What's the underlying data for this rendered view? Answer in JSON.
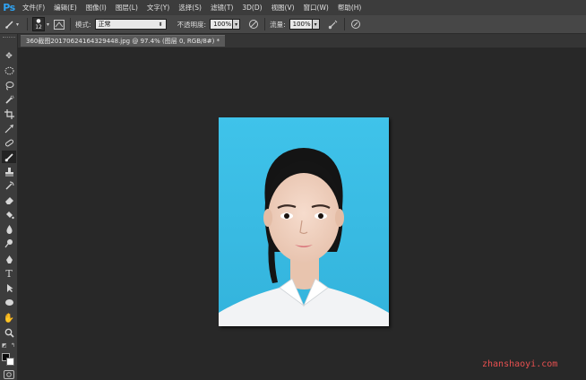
{
  "app": {
    "logo": "Ps"
  },
  "menu": [
    "文件(F)",
    "编辑(E)",
    "图像(I)",
    "图层(L)",
    "文字(Y)",
    "选择(S)",
    "滤镜(T)",
    "3D(D)",
    "视图(V)",
    "窗口(W)",
    "帮助(H)"
  ],
  "options": {
    "brush_size": "12",
    "mode_label": "模式:",
    "mode_value": "正常",
    "opacity_label": "不透明度:",
    "opacity_value": "100%",
    "flow_label": "流量:",
    "flow_value": "100%"
  },
  "document": {
    "tab_title": "360截图20170624164329448.jpg @ 97.4% (图层 0, RGB/8#) *"
  },
  "colors": {
    "foreground": "#0a0a0a",
    "background": "#ffffff",
    "photo_background": "#3cbde4"
  },
  "tools": [
    "move-icon",
    "marquee-icon",
    "lasso-icon",
    "quick-selection-icon",
    "crop-icon",
    "eyedropper-icon",
    "healing-brush-icon",
    "brush-icon",
    "clone-stamp-icon",
    "history-brush-icon",
    "eraser-icon",
    "paint-bucket-icon",
    "blur-icon",
    "dodge-icon",
    "pen-icon",
    "type-icon",
    "path-selection-icon",
    "ellipse-icon",
    "hand-icon",
    "zoom-icon"
  ],
  "watermark": "zhanshaoyi.com"
}
